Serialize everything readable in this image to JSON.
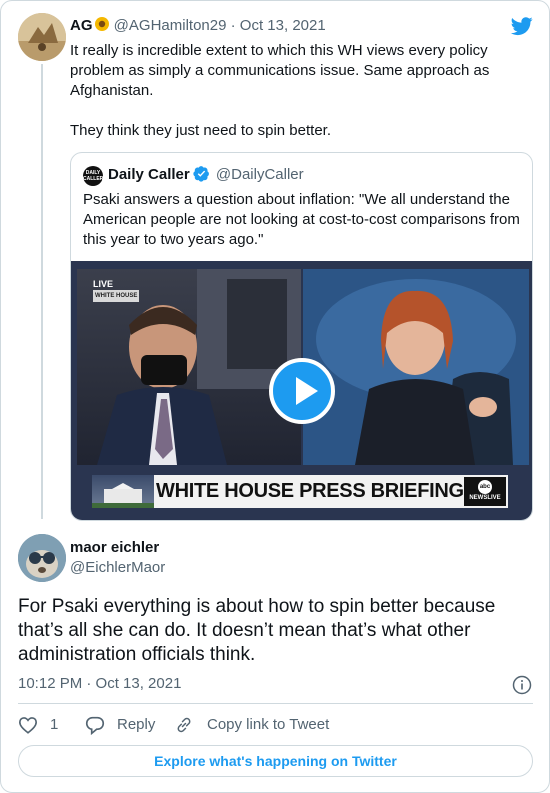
{
  "parent_tweet": {
    "author_name": "AG",
    "handle": "@AGHamilton29",
    "separator": "·",
    "date": "Oct 13, 2021",
    "text": "It really is incredible extent to which this WH views every policy problem as simply a communications issue. Same approach as Afghanistan.\n\nThey think they just need to spin better."
  },
  "quoted_tweet": {
    "author_name": "Daily Caller",
    "handle": "@DailyCaller",
    "avatar_text": "DAILY CALLER",
    "text": "Psaki answers a question about inflation: \"We all understand the American people are not looking at cost-to-cost comparisons from this year to two years ago.\"",
    "video": {
      "live_label": "LIVE",
      "live_sub": "WHITE HOUSE",
      "banner_text": "WHITE HOUSE PRESS BRIEFING",
      "network_logo": "abc",
      "network_sub": "NEWSLIVE"
    }
  },
  "reply_tweet": {
    "author_name": "maor eichler",
    "handle": "@EichlerMaor",
    "text": "For Psaki everything is about how to spin better because that’s all she can do. It doesn’t mean that’s what other administration officials think.",
    "timestamp": "10:12 PM · Oct 13, 2021"
  },
  "actions": {
    "like_count": "1",
    "reply_label": "Reply",
    "copy_link_label": "Copy link to Tweet"
  },
  "explore_label": "Explore what's happening on Twitter",
  "colors": {
    "twitter_blue": "#1d9bf0",
    "text_primary": "#0f1419",
    "text_secondary": "#536471",
    "border": "#cfd9de"
  },
  "icons": {
    "brand": "twitter-bird-icon",
    "verified": "verified-badge-icon",
    "emoji": "sunflower-emoji-icon",
    "play": "play-icon",
    "info": "info-icon",
    "like": "heart-icon",
    "reply": "reply-bubble-icon",
    "copy_link": "link-icon"
  }
}
